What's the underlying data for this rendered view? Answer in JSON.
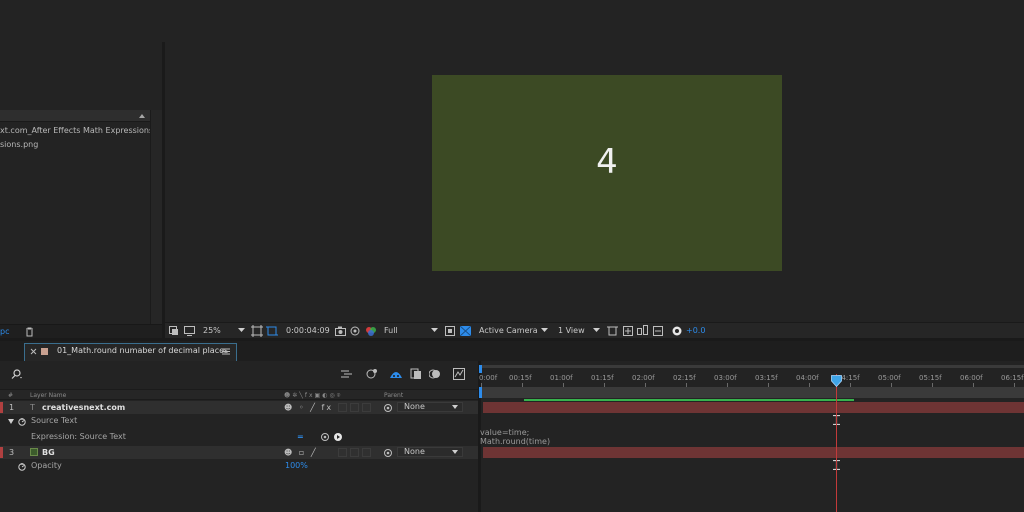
{
  "project": {
    "rows": [
      "xt.com_After Effects Math Expressions",
      "sions.png"
    ],
    "footer_label": "pc"
  },
  "composition": {
    "display_value": "4",
    "canvas_color": "#3c4a24"
  },
  "viewer_toolbar": {
    "zoom": "25%",
    "timecode": "0:00:04:09",
    "resolution": "Full",
    "camera": "Active Camera",
    "view_layout": "1 View",
    "exposure": "+0.0"
  },
  "timeline": {
    "tab_title": "01_Math.round numaber of decimal places",
    "col_headers": {
      "layer_name": "Layer Name",
      "parent": "Parent"
    },
    "ruler_labels": [
      "0:00f",
      "00:15f",
      "01:00f",
      "01:15f",
      "02:00f",
      "02:15f",
      "03:00f",
      "03:15f",
      "04:00f",
      "04:15f",
      "05:00f",
      "05:15f",
      "06:00f",
      "06:15f"
    ],
    "layers": [
      {
        "num": "1",
        "name": "creativesnext.com",
        "type_icon": "T",
        "parent": "None",
        "property": "Source Text",
        "expression_label": "Expression: Source Text",
        "expression_lines": [
          "value=time;",
          "Math.round(time)"
        ]
      },
      {
        "num": "3",
        "name": "BG",
        "parent": "None",
        "property": "Opacity",
        "property_value": "100%"
      }
    ]
  },
  "colors": {
    "accent": "#2d8ceb",
    "layer_bar": "#6e3434",
    "label_red": "#b04040",
    "label_green": "#3c5c2c"
  }
}
